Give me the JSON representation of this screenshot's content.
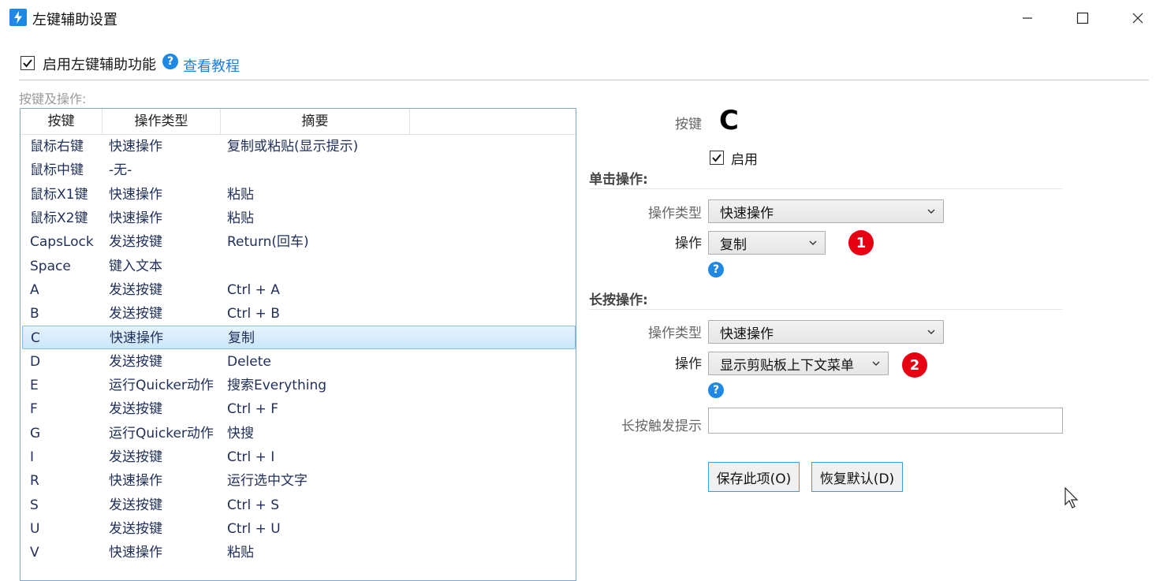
{
  "window": {
    "title": "左键辅助设置"
  },
  "top": {
    "enable_label": "启用左键辅助功能",
    "enable_checked": true,
    "tutorial_link": "查看教程"
  },
  "list": {
    "group_label": "按键及操作:",
    "columns": [
      "按键",
      "操作类型",
      "摘要"
    ],
    "rows": [
      {
        "key": "鼠标右键",
        "type": "快速操作",
        "summary": "复制或粘贴(显示提示)"
      },
      {
        "key": "鼠标中键",
        "type": "-无-",
        "summary": ""
      },
      {
        "key": "鼠标X1键",
        "type": "快速操作",
        "summary": "粘贴"
      },
      {
        "key": "鼠标X2键",
        "type": "快速操作",
        "summary": "粘贴"
      },
      {
        "key": "CapsLock",
        "type": "发送按键",
        "summary": "Return(回车)"
      },
      {
        "key": "Space",
        "type": "键入文本",
        "summary": ""
      },
      {
        "key": "A",
        "type": "发送按键",
        "summary": "Ctrl + A"
      },
      {
        "key": "B",
        "type": "发送按键",
        "summary": "Ctrl + B"
      },
      {
        "key": "C",
        "type": "快速操作",
        "summary": "复制"
      },
      {
        "key": "D",
        "type": "发送按键",
        "summary": "Delete"
      },
      {
        "key": "E",
        "type": "运行Quicker动作",
        "summary": "搜索Everything"
      },
      {
        "key": "F",
        "type": "发送按键",
        "summary": "Ctrl + F"
      },
      {
        "key": "G",
        "type": "运行Quicker动作",
        "summary": "快搜"
      },
      {
        "key": "I",
        "type": "发送按键",
        "summary": "Ctrl + I"
      },
      {
        "key": "R",
        "type": "快速操作",
        "summary": "运行选中文字"
      },
      {
        "key": "S",
        "type": "发送按键",
        "summary": "Ctrl + S"
      },
      {
        "key": "U",
        "type": "发送按键",
        "summary": "Ctrl + U"
      },
      {
        "key": "V",
        "type": "快速操作",
        "summary": "粘贴"
      }
    ],
    "selected_index": 8
  },
  "detail": {
    "key_label": "按键",
    "key_value": "C",
    "enabled_label": "启用",
    "enabled_checked": true,
    "click_section": "单击操作:",
    "click_type_label": "操作类型",
    "click_type_value": "快速操作",
    "click_op_label": "操作",
    "click_op_value": "复制",
    "badge1": "1",
    "long_section": "长按操作:",
    "long_type_label": "操作类型",
    "long_type_value": "快速操作",
    "long_op_label": "操作",
    "long_op_value": "显示剪贴板上下文菜单",
    "badge2": "2",
    "long_hint_label": "长按触发提示",
    "long_hint_value": "",
    "save_button": "保存此项(O)",
    "reset_button": "恢复默认(D)"
  },
  "colors": {
    "accent": "#1e88e5",
    "link": "#1e7fd8",
    "badge": "#e60012",
    "selection": "#c9e6fb"
  }
}
